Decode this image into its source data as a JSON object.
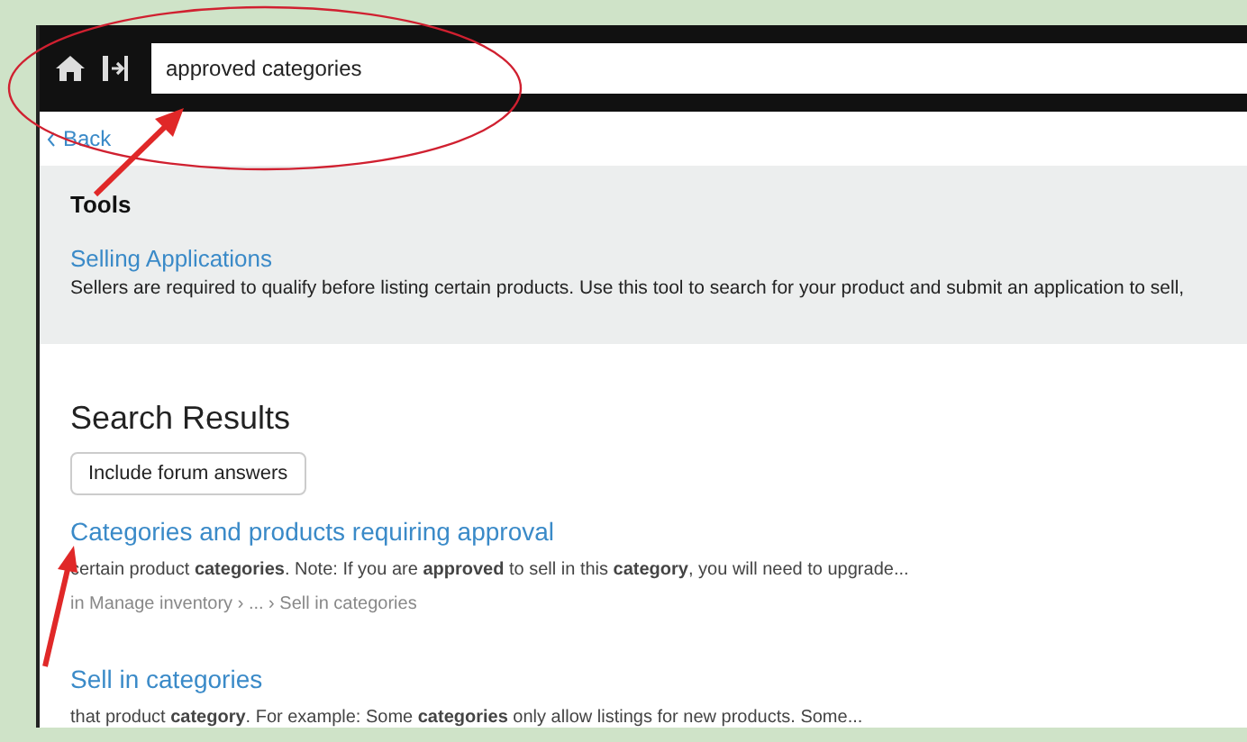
{
  "toolbar": {
    "search_value": "approved categories"
  },
  "back_link": "Back",
  "tools": {
    "heading": "Tools",
    "link": "Selling Applications",
    "description": "Sellers are required to qualify before listing certain products. Use this tool to search for your product and submit an application to sell,"
  },
  "search_results": {
    "heading": "Search Results",
    "filter_button": "Include forum answers",
    "results": [
      {
        "title": "Categories and products requiring approval",
        "snippet": "certain product **categories**. Note: If you are **approved** to sell in this **category**, you will need to upgrade...",
        "path": "in Manage inventory › ... › Sell in categories"
      },
      {
        "title": "Sell in categories",
        "snippet": "that product **category**. For example: Some **categories** only allow listings for new products. Some..."
      }
    ]
  }
}
